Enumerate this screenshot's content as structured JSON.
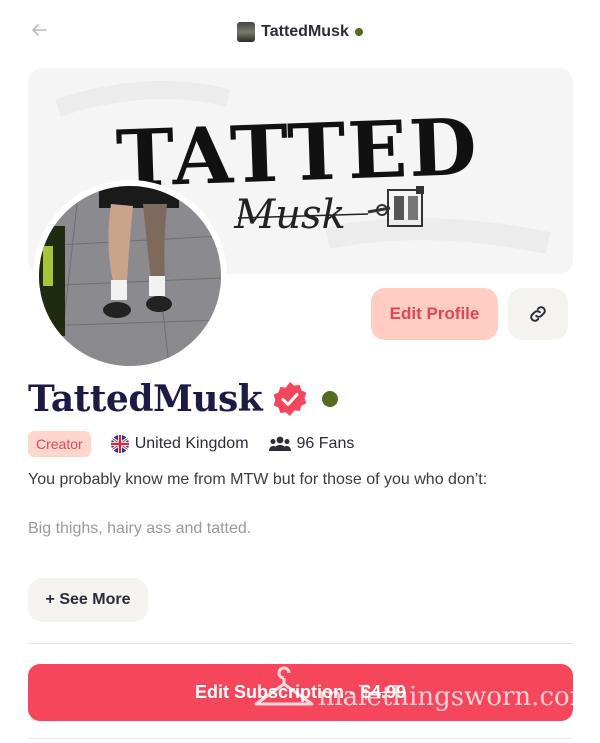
{
  "header": {
    "back_icon": "arrow-left-icon",
    "title": "TattedMusk",
    "online": true
  },
  "banner": {
    "title_text": "TATTED",
    "script_text": "Musk",
    "icon": "tattoo-machine-icon"
  },
  "actions": {
    "edit_profile_label": "Edit Profile",
    "link_icon": "link-icon"
  },
  "profile": {
    "name": "TattedMusk",
    "verified_icon": "verified-badge-icon",
    "online": true,
    "badge": "Creator",
    "location_flag": "uk-flag-icon",
    "location": "United Kingdom",
    "fans_icon": "users-icon",
    "fans": "96 Fans",
    "bio_line1": "You probably know me from MTW but for those of you who don’t:",
    "bio_line2": "Big thighs, hairy ass and tatted.",
    "see_more_label": "+ See More"
  },
  "subscription": {
    "label": "Edit Subscription - ",
    "price": "$4.99"
  },
  "watermark": {
    "text": "malethingsworn.com",
    "icon": "hanger-icon"
  },
  "colors": {
    "accent": "#f6465c",
    "badge_bg": "#ffd6cc",
    "online": "#556b1f",
    "name": "#1b1b45"
  }
}
